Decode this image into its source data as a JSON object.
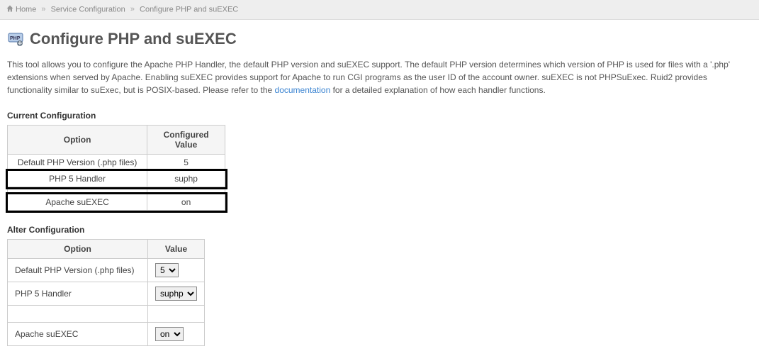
{
  "breadcrumb": {
    "home": "Home",
    "service_config": "Service Configuration",
    "current": "Configure PHP and suEXEC"
  },
  "page_title": "Configure PHP and suEXEC",
  "description_parts": {
    "pre": "This tool allows you to configure the Apache PHP Handler, the default PHP version and suEXEC support. The default PHP version determines which version of PHP is used for files with a '.php' extensions when served by Apache. Enabling suEXEC provides support for Apache to run CGI programs as the user ID of the account owner. suEXEC is not PHPSuExec. Ruid2 provides functionality similar to suExec, but is POSIX-based. Please refer to the ",
    "link_text": "documentation",
    "post": " for a detailed explanation of how each handler functions."
  },
  "sections": {
    "current": "Current Configuration",
    "alter": "Alter Configuration"
  },
  "current_table": {
    "headers": {
      "option": "Option",
      "value": "Configured Value"
    },
    "rows": [
      {
        "option": "Default PHP Version (.php files)",
        "value": "5"
      },
      {
        "option": "PHP 5 Handler",
        "value": "suphp"
      },
      {
        "option": "",
        "value": ""
      },
      {
        "option": "Apache suEXEC",
        "value": "on"
      }
    ]
  },
  "alter_table": {
    "headers": {
      "option": "Option",
      "value": "Value"
    },
    "rows": [
      {
        "option": "Default PHP Version (.php files)",
        "selected": "5"
      },
      {
        "option": "PHP 5 Handler",
        "selected": "suphp"
      },
      {
        "option": "",
        "selected": ""
      },
      {
        "option": "Apache suEXEC",
        "selected": "on"
      }
    ]
  }
}
